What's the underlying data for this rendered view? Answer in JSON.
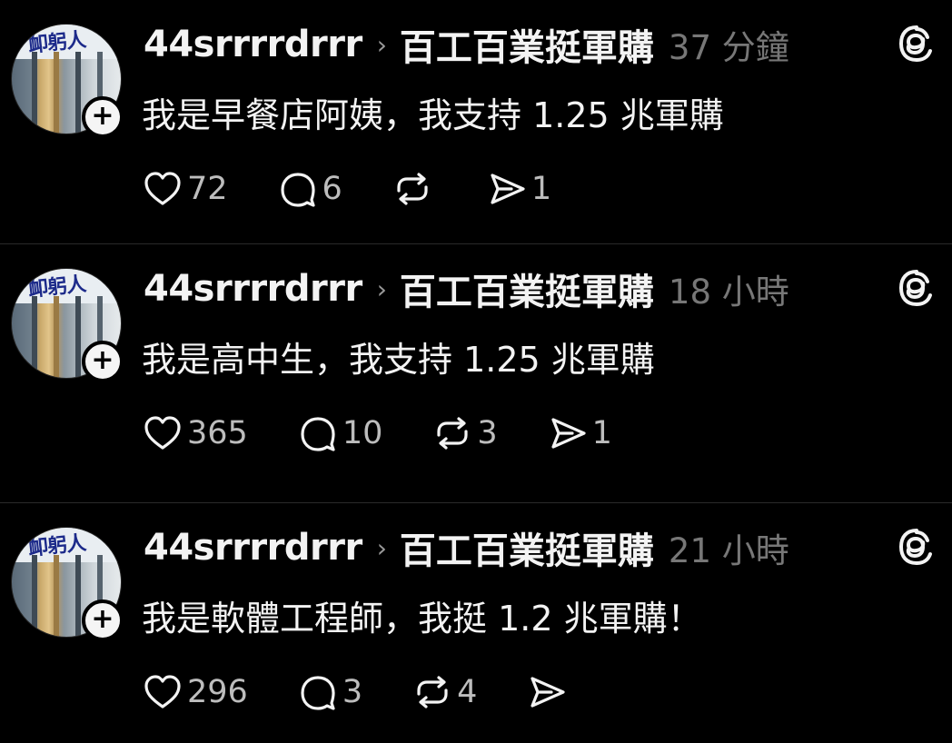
{
  "posts": [
    {
      "avatar_sign": "卹躬人",
      "username": "44srrrrdrrr",
      "community": "百工百業挺軍購",
      "time": "37 分鐘",
      "text": "我是早餐店阿姨，我支持 1.25 兆軍購",
      "likes": "72",
      "replies": "6",
      "reposts": "",
      "shares": "1"
    },
    {
      "avatar_sign": "卹躬人",
      "username": "44srrrrdrrr",
      "community": "百工百業挺軍購",
      "time": "18 小時",
      "text": "我是高中生，我支持 1.25 兆軍購",
      "likes": "365",
      "replies": "10",
      "reposts": "3",
      "shares": "1"
    },
    {
      "avatar_sign": "卹躬人",
      "username": "44srrrrdrrr",
      "community": "百工百業挺軍購",
      "time": "21 小時",
      "text": "我是軟體工程師，我挺 1.2 兆軍購！",
      "likes": "296",
      "replies": "3",
      "reposts": "4",
      "shares": ""
    }
  ],
  "icons": {
    "like": "heart-icon",
    "reply": "comment-icon",
    "repost": "repost-icon",
    "share": "share-icon",
    "follow": "plus-icon",
    "app": "threads-icon"
  },
  "colors": {
    "background": "#000000",
    "text": "#f3f3f3",
    "muted": "#777777",
    "counts": "#bdbdbd",
    "divider": "#2a2a2a"
  }
}
